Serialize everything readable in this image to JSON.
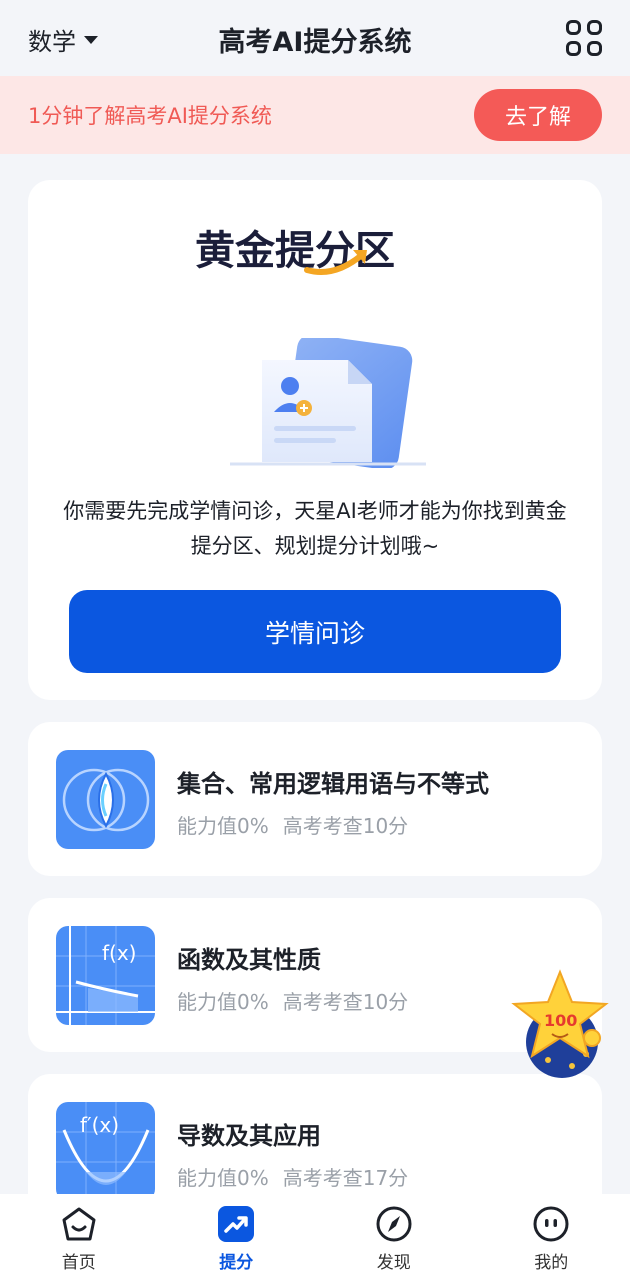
{
  "header": {
    "subject": "数学",
    "title": "高考AI提分系统"
  },
  "promo": {
    "text": "1分钟了解高考AI提分系统",
    "button_label": "去了解"
  },
  "gold_zone": {
    "logo_text": "黄金提分区",
    "description": "你需要先完成学情问诊，天星AI老师才能为你找到黄金提分区、规划提分计划哦~",
    "button_label": "学情问诊"
  },
  "topics": [
    {
      "title": "集合、常用逻辑用语与不等式",
      "ability": "能力值0%",
      "exam": "高考考查10分",
      "thumb_icon": "venn-diagram-icon"
    },
    {
      "title": "函数及其性质",
      "ability": "能力值0%",
      "exam": "高考考查10分",
      "thumb_icon": "function-graph-icon",
      "thumb_label": "f(x)"
    },
    {
      "title": "导数及其应用",
      "ability": "能力值0%",
      "exam": "高考考查17分",
      "thumb_icon": "derivative-curve-icon",
      "thumb_label": "f′(x)"
    }
  ],
  "mascot": {
    "badge_text": "100"
  },
  "nav": {
    "items": [
      {
        "label": "首页",
        "icon": "home-icon"
      },
      {
        "label": "提分",
        "icon": "trend-up-icon",
        "active": true
      },
      {
        "label": "发现",
        "icon": "compass-icon"
      },
      {
        "label": "我的",
        "icon": "profile-face-icon"
      }
    ]
  },
  "colors": {
    "primary": "#0b57e0",
    "promo_bg": "#fde7e6",
    "promo_accent": "#f45a57",
    "topic_thumb": "#4a8ef6"
  }
}
